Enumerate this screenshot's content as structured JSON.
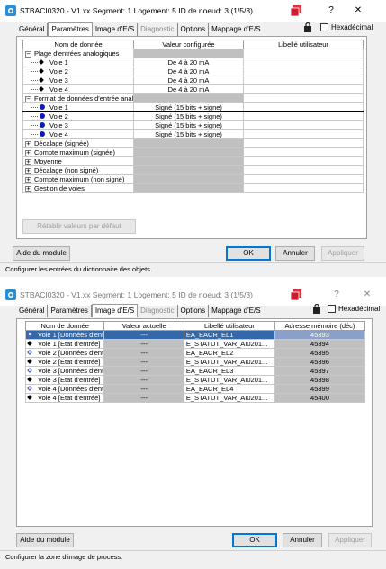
{
  "dialog1": {
    "title": "STBACI0320 - V1.xx Segment: 1 Logement: 5 ID de noeud: 3 (1/5/3)",
    "tabs": [
      {
        "label": "Général",
        "state": "normal"
      },
      {
        "label": "Paramètres",
        "state": "active"
      },
      {
        "label": "Image d'E/S",
        "state": "normal"
      },
      {
        "label": "Diagnostic",
        "state": "disabled"
      },
      {
        "label": "Options",
        "state": "normal"
      },
      {
        "label": "Mappage d'E/S",
        "state": "normal"
      }
    ],
    "hexadecimal_label": "Hexadécimal",
    "columns": [
      "Nom de donnée",
      "Valeur configurée",
      "Libellé utilisateur"
    ],
    "rows": [
      {
        "type": "group",
        "expander": "⊟",
        "name": "Plage d'entrées analogiques",
        "value": "",
        "grey": true
      },
      {
        "type": "diamond",
        "name": "Voie 1",
        "value": "De 4 à 20 mA"
      },
      {
        "type": "diamond",
        "name": "Voie 2",
        "value": "De 4 à 20 mA"
      },
      {
        "type": "diamond",
        "name": "Voie 3",
        "value": "De 4 à 20 mA"
      },
      {
        "type": "diamond",
        "name": "Voie 4",
        "value": "De 4 à 20 mA"
      },
      {
        "type": "group",
        "expander": "⊟",
        "name": "Format de données d'entrée anal...",
        "value": "",
        "grey": true
      },
      {
        "type": "dot",
        "name": "Voie 1",
        "value": "Signé (15 bits + signe)",
        "selected": true
      },
      {
        "type": "dot",
        "name": "Voie 2",
        "value": "Signé (15 bits + signe)"
      },
      {
        "type": "dot",
        "name": "Voie 3",
        "value": "Signé (15 bits + signe)"
      },
      {
        "type": "dot",
        "name": "Voie 4",
        "value": "Signé (15 bits + signe)"
      },
      {
        "type": "group",
        "expander": "⊞",
        "name": "Décalage (signée)",
        "value": "",
        "grey": true
      },
      {
        "type": "group",
        "expander": "⊞",
        "name": "Compte maximum (signée)",
        "value": "",
        "grey": true
      },
      {
        "type": "group",
        "expander": "⊞",
        "name": "Moyenne",
        "value": "",
        "grey": true
      },
      {
        "type": "group",
        "expander": "⊞",
        "name": "Décalage (non signé)",
        "value": "",
        "grey": true
      },
      {
        "type": "group",
        "expander": "⊞",
        "name": "Compte maximum (non signé)",
        "value": "",
        "grey": true
      },
      {
        "type": "group",
        "expander": "⊞",
        "name": "Gestion de voies",
        "value": "",
        "grey": true
      }
    ],
    "restore_button": "Rétablir valeurs par défaut",
    "help_button": "Aide du module",
    "ok_button": "OK",
    "cancel_button": "Annuler",
    "apply_button": "Appliquer",
    "status_text": "Configurer les entrées du dictionnaire des objets."
  },
  "dialog2": {
    "title": "STBACI0320 - V1.xx Segment: 1 Logement: 5 ID de noeud: 3 (1/5/3)",
    "tabs": [
      {
        "label": "Général",
        "state": "normal"
      },
      {
        "label": "Paramètres",
        "state": "normal"
      },
      {
        "label": "Image d'E/S",
        "state": "active"
      },
      {
        "label": "Diagnostic",
        "state": "disabled"
      },
      {
        "label": "Options",
        "state": "normal"
      },
      {
        "label": "Mappage d'E/S",
        "state": "normal"
      }
    ],
    "hexadecimal_label": "Hexadécimal",
    "columns": [
      "Nom de donnée",
      "Valeur actuelle",
      "Libellé utilisateur",
      "Adresse mémoire (déc)"
    ],
    "rows": [
      {
        "icon": "hollow",
        "name": "Voie 1 [Données d'entr...",
        "value": "---",
        "label": "EA_EACR_EL1",
        "address": "45393",
        "highlight": true
      },
      {
        "icon": "filled",
        "name": "Voie 1 [Etat d'entrée]",
        "value": "---",
        "label": "E_STATUT_VAR_AI0201...",
        "address": "45394"
      },
      {
        "icon": "hollow",
        "name": "Voie 2 [Données d'entr...",
        "value": "---",
        "label": "EA_EACR_EL2",
        "address": "45395"
      },
      {
        "icon": "filled",
        "name": "Voie 2 [Etat d'entrée]",
        "value": "---",
        "label": "E_STATUT_VAR_AI0201...",
        "address": "45396"
      },
      {
        "icon": "hollow",
        "name": "Voie 3 [Données d'entr...",
        "value": "---",
        "label": "EA_EACR_EL3",
        "address": "45397"
      },
      {
        "icon": "filled",
        "name": "Voie 3 [Etat d'entrée]",
        "value": "---",
        "label": "E_STATUT_VAR_AI0201...",
        "address": "45398"
      },
      {
        "icon": "hollow",
        "name": "Voie 4 [Données d'entr...",
        "value": "---",
        "label": "EA_EACR_EL4",
        "address": "45399"
      },
      {
        "icon": "filled",
        "name": "Voie 4 [Etat d'entrée]",
        "value": "---",
        "label": "E_STATUT_VAR_AI0201...",
        "address": "45400"
      }
    ],
    "help_button": "Aide du module",
    "ok_button": "OK",
    "cancel_button": "Annuler",
    "apply_button": "Appliquer",
    "status_text": "Configurer la zone d'image de process."
  },
  "titlebar": {
    "help_glyph": "?",
    "close_glyph": "✕"
  },
  "colors": {
    "highlight": "#3468a8",
    "grey_cell": "#c0c0c0",
    "dot_blue": "#0b1dbe",
    "dialog_bg": "#f0f0f0"
  },
  "icons": [
    "app-icon",
    "windows-icon",
    "lock-icon",
    "expand-icon",
    "collapse-icon",
    "diamond-icon",
    "dot-icon"
  ]
}
